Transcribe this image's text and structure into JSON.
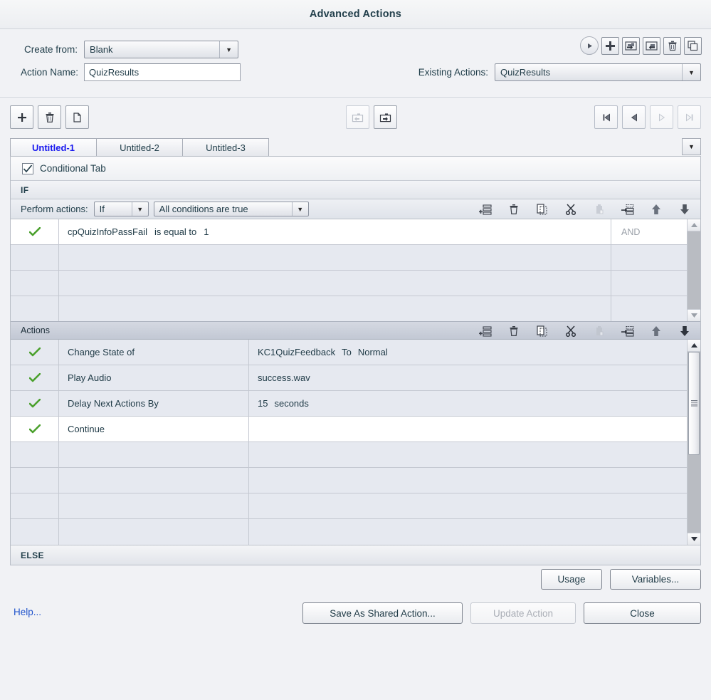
{
  "window": {
    "title": "Advanced Actions"
  },
  "form": {
    "create_from_label": "Create from:",
    "create_from_value": "Blank",
    "action_name_label": "Action Name:",
    "action_name_value": "QuizResults",
    "existing_actions_label": "Existing Actions:",
    "existing_actions_value": "QuizResults"
  },
  "top_icons": [
    {
      "name": "preview-play-icon",
      "title": "Preview"
    },
    {
      "name": "add-icon",
      "title": "Add"
    },
    {
      "name": "export-folder-icon",
      "title": "Export"
    },
    {
      "name": "import-folder-icon",
      "title": "Import"
    },
    {
      "name": "delete-trash-icon",
      "title": "Delete"
    },
    {
      "name": "duplicate-icon",
      "title": "Duplicate"
    }
  ],
  "toolbar": {
    "left": [
      {
        "name": "add-action-icon",
        "title": "Add Action"
      },
      {
        "name": "delete-action-icon",
        "title": "Delete Action"
      },
      {
        "name": "duplicate-action-icon",
        "title": "Duplicate Action"
      }
    ],
    "middle": [
      {
        "name": "import-shared-action-icon",
        "title": "Import Shared Action",
        "enabled": false
      },
      {
        "name": "export-shared-action-icon",
        "title": "Export Shared Action",
        "enabled": true
      }
    ],
    "right": [
      {
        "name": "first-tab-icon",
        "title": "First",
        "enabled": true
      },
      {
        "name": "previous-tab-icon",
        "title": "Previous",
        "enabled": true
      },
      {
        "name": "next-tab-icon",
        "title": "Next",
        "enabled": false
      },
      {
        "name": "last-tab-icon",
        "title": "Last",
        "enabled": false
      }
    ]
  },
  "tabs": {
    "items": [
      {
        "label": "Untitled-1",
        "active": true
      },
      {
        "label": "Untitled-2",
        "active": false
      },
      {
        "label": "Untitled-3",
        "active": false
      }
    ]
  },
  "conditional": {
    "checkbox_label": "Conditional Tab",
    "checked": true,
    "if_label": "IF",
    "else_label": "ELSE",
    "perform_actions_label": "Perform actions:",
    "perform_actions_value": "If",
    "condition_mode_value": "All conditions are true"
  },
  "row_tools": [
    {
      "name": "add-row-icon",
      "title": "Add Row",
      "enabled": true
    },
    {
      "name": "delete-row-icon",
      "title": "Delete Row",
      "enabled": true
    },
    {
      "name": "copy-row-icon",
      "title": "Copy Row",
      "enabled": true
    },
    {
      "name": "cut-row-icon",
      "title": "Cut Row",
      "enabled": true
    },
    {
      "name": "paste-row-icon",
      "title": "Paste Row",
      "enabled": false
    },
    {
      "name": "insert-row-icon",
      "title": "Insert Row",
      "enabled": true
    },
    {
      "name": "move-up-icon",
      "title": "Move Up",
      "enabled": true
    },
    {
      "name": "move-down-icon",
      "title": "Move Down",
      "enabled": true
    }
  ],
  "conditions": {
    "rows": [
      {
        "enabled": true,
        "variable": "cpQuizInfoPassFail",
        "operator": "is equal to",
        "value": "1",
        "logic": "AND"
      },
      {
        "enabled": false,
        "variable": "",
        "operator": "",
        "value": "",
        "logic": ""
      },
      {
        "enabled": false,
        "variable": "",
        "operator": "",
        "value": "",
        "logic": ""
      },
      {
        "enabled": false,
        "variable": "",
        "operator": "",
        "value": "",
        "logic": ""
      }
    ]
  },
  "actions": {
    "header_label": "Actions",
    "rows": [
      {
        "enabled": true,
        "action": "Change State of",
        "param1": "KC1QuizFeedback",
        "param2": "To",
        "param3": "Normal"
      },
      {
        "enabled": true,
        "action": "Play Audio",
        "param1": "success.wav",
        "param2": "",
        "param3": ""
      },
      {
        "enabled": true,
        "action": "Delay Next Actions By",
        "param1": "15",
        "param2": "seconds",
        "param3": ""
      },
      {
        "enabled": true,
        "action": "Continue",
        "param1": "",
        "param2": "",
        "param3": ""
      },
      {
        "enabled": false,
        "action": "",
        "param1": "",
        "param2": "",
        "param3": ""
      },
      {
        "enabled": false,
        "action": "",
        "param1": "",
        "param2": "",
        "param3": ""
      },
      {
        "enabled": false,
        "action": "",
        "param1": "",
        "param2": "",
        "param3": ""
      },
      {
        "enabled": false,
        "action": "",
        "param1": "",
        "param2": "",
        "param3": ""
      }
    ]
  },
  "footer": {
    "usage_label": "Usage",
    "variables_label": "Variables...",
    "help_label": "Help...",
    "save_shared_label": "Save As Shared Action...",
    "update_action_label": "Update Action",
    "update_action_enabled": false,
    "close_label": "Close"
  },
  "colors": {
    "dialog_bg": "#f1f2f5",
    "active_tab_text": "#1919ef",
    "link": "#2255cc",
    "check_green": "#4aa02c",
    "grid_alt": "#e6e9f0",
    "text": "#1f3a46"
  }
}
